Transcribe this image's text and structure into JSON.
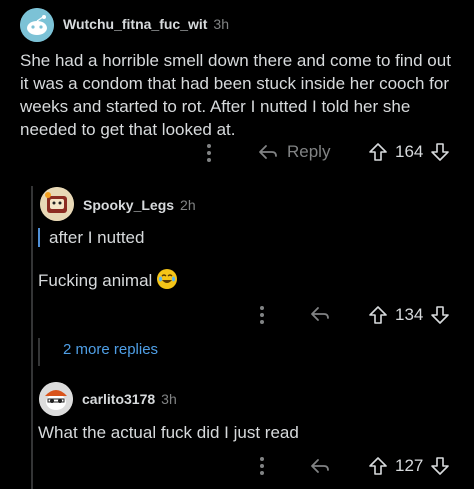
{
  "comment1": {
    "username": "Wutchu_fitna_fuc_wit",
    "time": "3h",
    "body": "She had a horrible smell down there and come to find out it was a condom that had been stuck inside her cooch for weeks and started to rot. After I nutted I told her she needed to get that looked at.",
    "reply_label": "Reply",
    "score": "164"
  },
  "comment2": {
    "username": "Spooky_Legs",
    "time": "2h",
    "quote": "after I nutted",
    "body": "Fucking animal",
    "score": "134"
  },
  "more_replies": "2 more replies",
  "comment3": {
    "username": "carlito3178",
    "time": "3h",
    "body": "What the actual fuck did I just read",
    "score": "127"
  }
}
